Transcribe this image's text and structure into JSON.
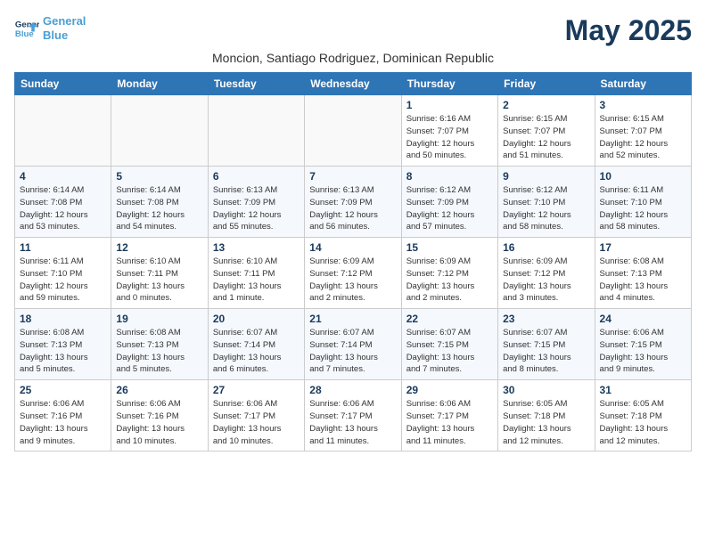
{
  "logo": {
    "line1": "General",
    "line2": "Blue"
  },
  "title": "May 2025",
  "subtitle": "Moncion, Santiago Rodriguez, Dominican Republic",
  "days_of_week": [
    "Sunday",
    "Monday",
    "Tuesday",
    "Wednesday",
    "Thursday",
    "Friday",
    "Saturday"
  ],
  "weeks": [
    [
      {
        "day": "",
        "info": ""
      },
      {
        "day": "",
        "info": ""
      },
      {
        "day": "",
        "info": ""
      },
      {
        "day": "",
        "info": ""
      },
      {
        "day": "1",
        "info": "Sunrise: 6:16 AM\nSunset: 7:07 PM\nDaylight: 12 hours\nand 50 minutes."
      },
      {
        "day": "2",
        "info": "Sunrise: 6:15 AM\nSunset: 7:07 PM\nDaylight: 12 hours\nand 51 minutes."
      },
      {
        "day": "3",
        "info": "Sunrise: 6:15 AM\nSunset: 7:07 PM\nDaylight: 12 hours\nand 52 minutes."
      }
    ],
    [
      {
        "day": "4",
        "info": "Sunrise: 6:14 AM\nSunset: 7:08 PM\nDaylight: 12 hours\nand 53 minutes."
      },
      {
        "day": "5",
        "info": "Sunrise: 6:14 AM\nSunset: 7:08 PM\nDaylight: 12 hours\nand 54 minutes."
      },
      {
        "day": "6",
        "info": "Sunrise: 6:13 AM\nSunset: 7:09 PM\nDaylight: 12 hours\nand 55 minutes."
      },
      {
        "day": "7",
        "info": "Sunrise: 6:13 AM\nSunset: 7:09 PM\nDaylight: 12 hours\nand 56 minutes."
      },
      {
        "day": "8",
        "info": "Sunrise: 6:12 AM\nSunset: 7:09 PM\nDaylight: 12 hours\nand 57 minutes."
      },
      {
        "day": "9",
        "info": "Sunrise: 6:12 AM\nSunset: 7:10 PM\nDaylight: 12 hours\nand 58 minutes."
      },
      {
        "day": "10",
        "info": "Sunrise: 6:11 AM\nSunset: 7:10 PM\nDaylight: 12 hours\nand 58 minutes."
      }
    ],
    [
      {
        "day": "11",
        "info": "Sunrise: 6:11 AM\nSunset: 7:10 PM\nDaylight: 12 hours\nand 59 minutes."
      },
      {
        "day": "12",
        "info": "Sunrise: 6:10 AM\nSunset: 7:11 PM\nDaylight: 13 hours\nand 0 minutes."
      },
      {
        "day": "13",
        "info": "Sunrise: 6:10 AM\nSunset: 7:11 PM\nDaylight: 13 hours\nand 1 minute."
      },
      {
        "day": "14",
        "info": "Sunrise: 6:09 AM\nSunset: 7:12 PM\nDaylight: 13 hours\nand 2 minutes."
      },
      {
        "day": "15",
        "info": "Sunrise: 6:09 AM\nSunset: 7:12 PM\nDaylight: 13 hours\nand 2 minutes."
      },
      {
        "day": "16",
        "info": "Sunrise: 6:09 AM\nSunset: 7:12 PM\nDaylight: 13 hours\nand 3 minutes."
      },
      {
        "day": "17",
        "info": "Sunrise: 6:08 AM\nSunset: 7:13 PM\nDaylight: 13 hours\nand 4 minutes."
      }
    ],
    [
      {
        "day": "18",
        "info": "Sunrise: 6:08 AM\nSunset: 7:13 PM\nDaylight: 13 hours\nand 5 minutes."
      },
      {
        "day": "19",
        "info": "Sunrise: 6:08 AM\nSunset: 7:13 PM\nDaylight: 13 hours\nand 5 minutes."
      },
      {
        "day": "20",
        "info": "Sunrise: 6:07 AM\nSunset: 7:14 PM\nDaylight: 13 hours\nand 6 minutes."
      },
      {
        "day": "21",
        "info": "Sunrise: 6:07 AM\nSunset: 7:14 PM\nDaylight: 13 hours\nand 7 minutes."
      },
      {
        "day": "22",
        "info": "Sunrise: 6:07 AM\nSunset: 7:15 PM\nDaylight: 13 hours\nand 7 minutes."
      },
      {
        "day": "23",
        "info": "Sunrise: 6:07 AM\nSunset: 7:15 PM\nDaylight: 13 hours\nand 8 minutes."
      },
      {
        "day": "24",
        "info": "Sunrise: 6:06 AM\nSunset: 7:15 PM\nDaylight: 13 hours\nand 9 minutes."
      }
    ],
    [
      {
        "day": "25",
        "info": "Sunrise: 6:06 AM\nSunset: 7:16 PM\nDaylight: 13 hours\nand 9 minutes."
      },
      {
        "day": "26",
        "info": "Sunrise: 6:06 AM\nSunset: 7:16 PM\nDaylight: 13 hours\nand 10 minutes."
      },
      {
        "day": "27",
        "info": "Sunrise: 6:06 AM\nSunset: 7:17 PM\nDaylight: 13 hours\nand 10 minutes."
      },
      {
        "day": "28",
        "info": "Sunrise: 6:06 AM\nSunset: 7:17 PM\nDaylight: 13 hours\nand 11 minutes."
      },
      {
        "day": "29",
        "info": "Sunrise: 6:06 AM\nSunset: 7:17 PM\nDaylight: 13 hours\nand 11 minutes."
      },
      {
        "day": "30",
        "info": "Sunrise: 6:05 AM\nSunset: 7:18 PM\nDaylight: 13 hours\nand 12 minutes."
      },
      {
        "day": "31",
        "info": "Sunrise: 6:05 AM\nSunset: 7:18 PM\nDaylight: 13 hours\nand 12 minutes."
      }
    ]
  ]
}
